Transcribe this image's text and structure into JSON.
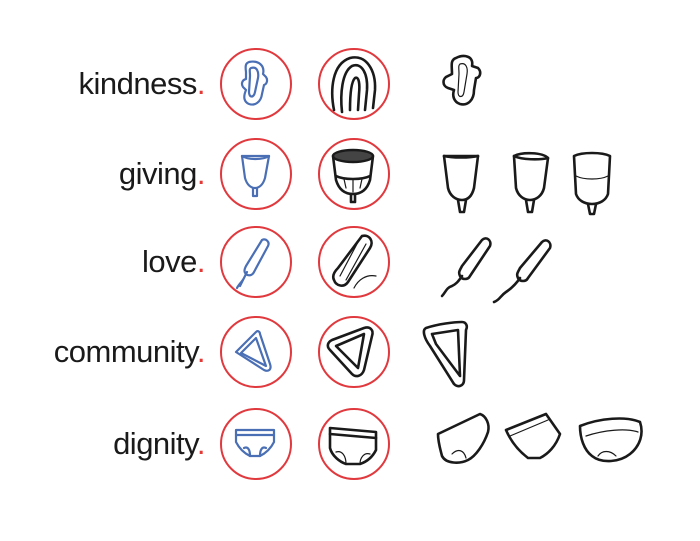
{
  "rows": [
    {
      "word": "kindness",
      "dot": ".",
      "icon": "pad-icon"
    },
    {
      "word": "giving",
      "dot": ".",
      "icon": "menstrual-cup-icon"
    },
    {
      "word": "love",
      "dot": ".",
      "icon": "tampon-icon"
    },
    {
      "word": "community",
      "dot": ".",
      "icon": "menstrual-disc-icon"
    },
    {
      "word": "dignity",
      "dot": ".",
      "icon": "period-underwear-icon"
    }
  ],
  "colors": {
    "ring": "#e0393e",
    "dot": "#e53935",
    "blue_icon": "#4a6fb5",
    "black_icon": "#1a1a1a",
    "text": "#1a1a1a"
  }
}
